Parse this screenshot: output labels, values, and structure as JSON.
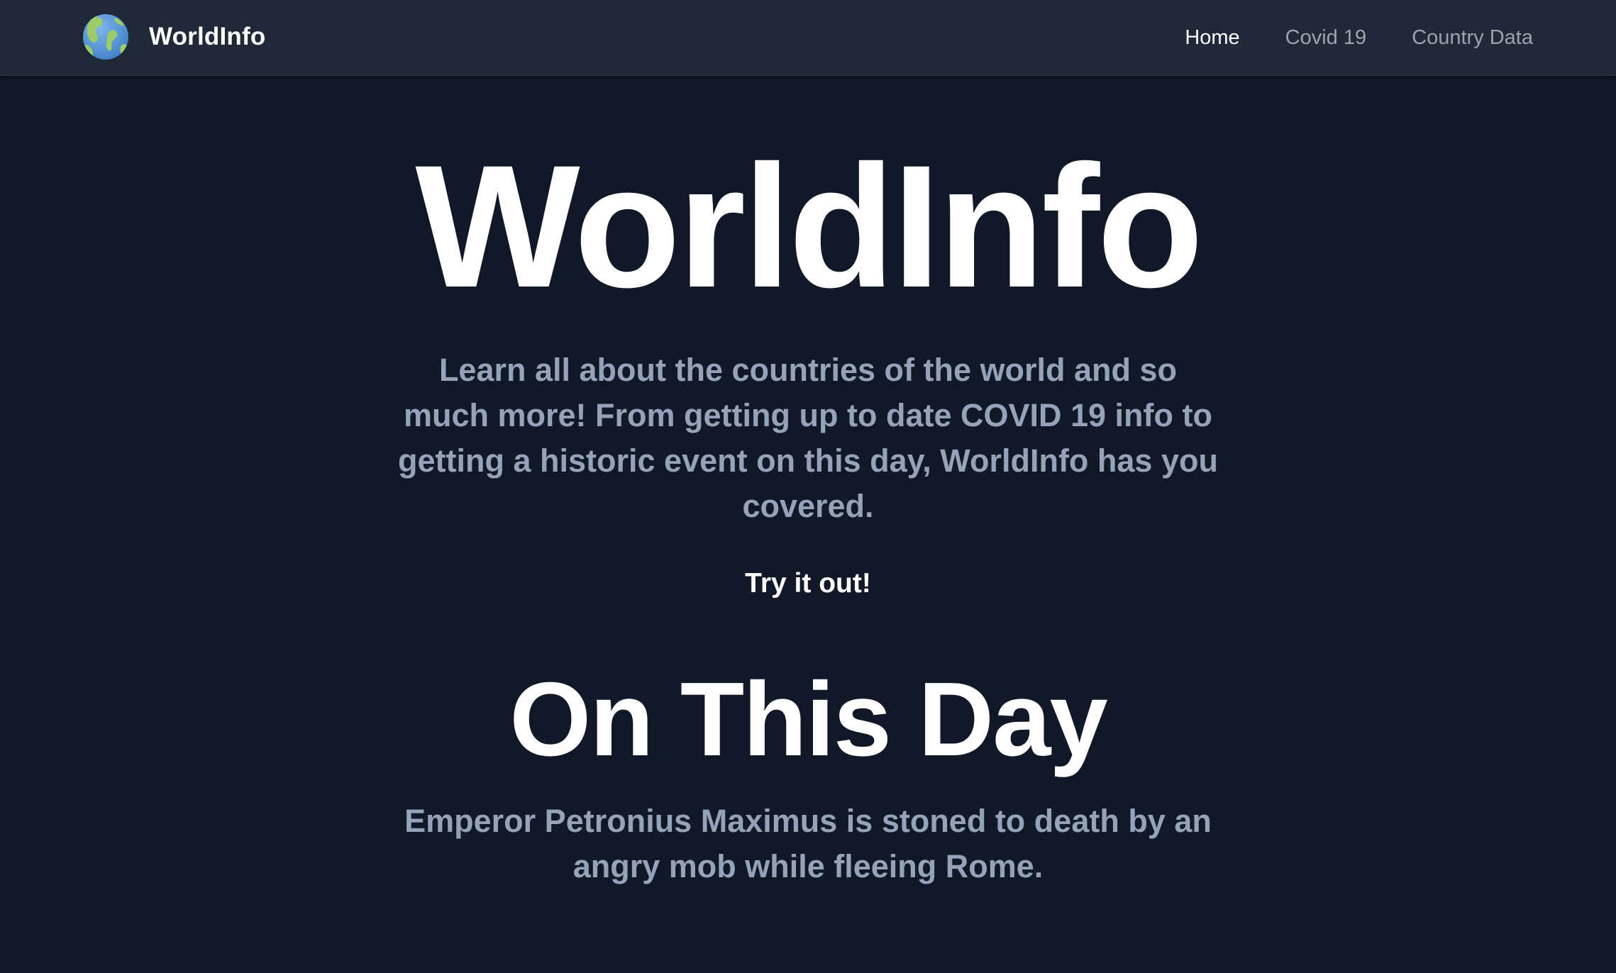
{
  "brand": {
    "name": "WorldInfo",
    "logo_icon": "globe-icon"
  },
  "nav": {
    "items": [
      {
        "label": "Home",
        "active": true
      },
      {
        "label": "Covid 19",
        "active": false
      },
      {
        "label": "Country Data",
        "active": false
      }
    ]
  },
  "hero": {
    "title": "WorldInfo",
    "description": "Learn all about the countries of the world and so much more! From getting up to date COVID 19 info to getting a historic event on this day, WorldInfo has you covered.",
    "cta_label": "Try it out!"
  },
  "on_this_day": {
    "title": "On This Day",
    "event": "Emperor Petronius Maximus is stoned to death by an angry mob while fleeing Rome."
  },
  "colors": {
    "background": "#111827",
    "navbar": "#1f2937",
    "muted_text": "#94a3b8",
    "nav_inactive": "#9ca3af",
    "white": "#ffffff"
  }
}
